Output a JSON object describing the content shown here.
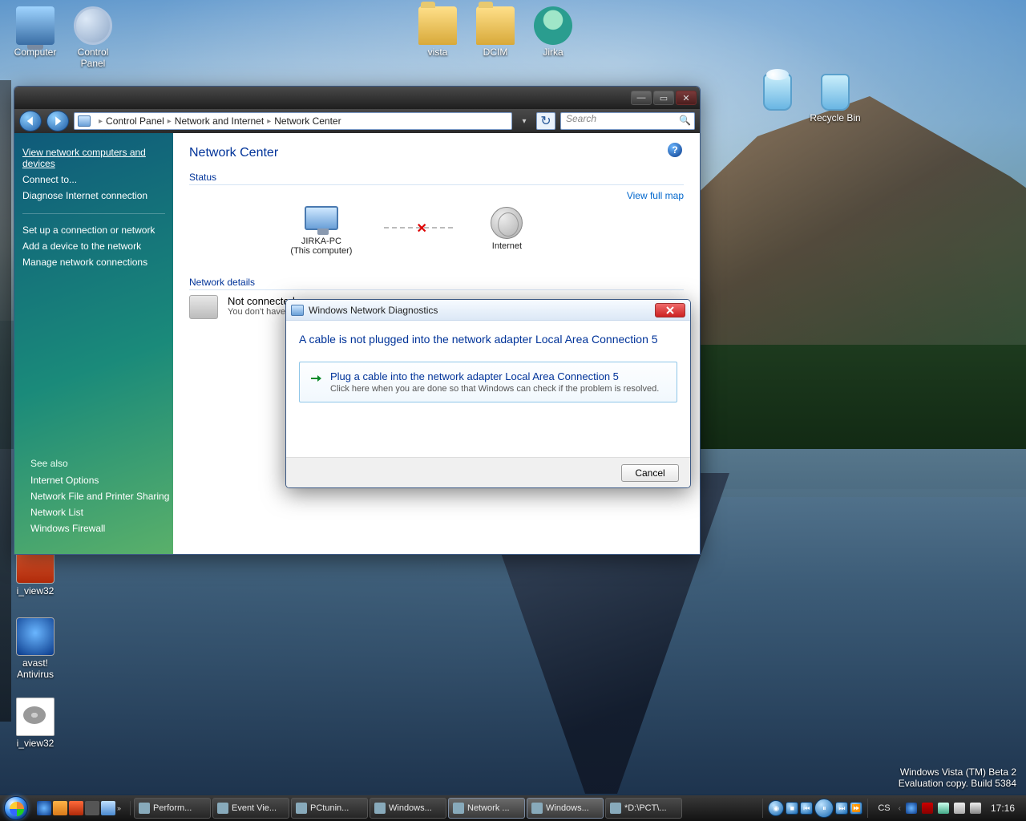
{
  "desktop_icons": {
    "computer": "Computer",
    "control_panel": "Control\nPanel",
    "vista": "vista",
    "dcim": "DCIM",
    "jirka": "Jirka",
    "recycle_bin": "Recycle Bin",
    "i_view32": "i_view32",
    "avast": "avast!\nAntivirus",
    "i_view32_b": "i_view32"
  },
  "explorer": {
    "breadcrumbs": [
      "Control Panel",
      "Network and Internet",
      "Network Center"
    ],
    "search_placeholder": "Search",
    "sidebar": {
      "grp1": [
        "View network computers and devices",
        "Connect to...",
        "Diagnose Internet connection"
      ],
      "grp2": [
        "Set up a connection or network",
        "Add a device to the network",
        "Manage network connections"
      ],
      "see_also_label": "See also",
      "see_also": [
        "Internet Options",
        "Network File and Printer Sharing",
        "Network List",
        "Windows Firewall"
      ]
    },
    "page_title": "Network Center",
    "status_label": "Status",
    "view_full_map": "View full map",
    "node_pc_name": "JIRKA-PC",
    "node_pc_sub": "(This computer)",
    "node_internet": "Internet",
    "details_label": "Network details",
    "not_connected_title": "Not connected",
    "not_connected_sub": "You don't have"
  },
  "dialog": {
    "title": "Windows Network Diagnostics",
    "message": "A cable is not plugged into the network adapter Local Area Connection 5",
    "action_title": "Plug a cable into the network adapter Local Area Connection 5",
    "action_sub": "Click here when you are done so that Windows can check if the problem is resolved.",
    "cancel": "Cancel"
  },
  "taskbar": {
    "tasks": [
      {
        "label": "Perform...",
        "active": false
      },
      {
        "label": "Event Vie...",
        "active": false
      },
      {
        "label": "PCtunin...",
        "active": false
      },
      {
        "label": "Windows...",
        "active": false
      },
      {
        "label": "Network ...",
        "active": true
      },
      {
        "label": "Windows...",
        "active": true
      },
      {
        "label": "*D:\\PCT\\...",
        "active": false
      }
    ],
    "lang": "CS",
    "clock": "17:16"
  },
  "watermark": {
    "l1": "Windows Vista (TM) Beta 2",
    "l2": "Evaluation copy. Build 5384"
  }
}
